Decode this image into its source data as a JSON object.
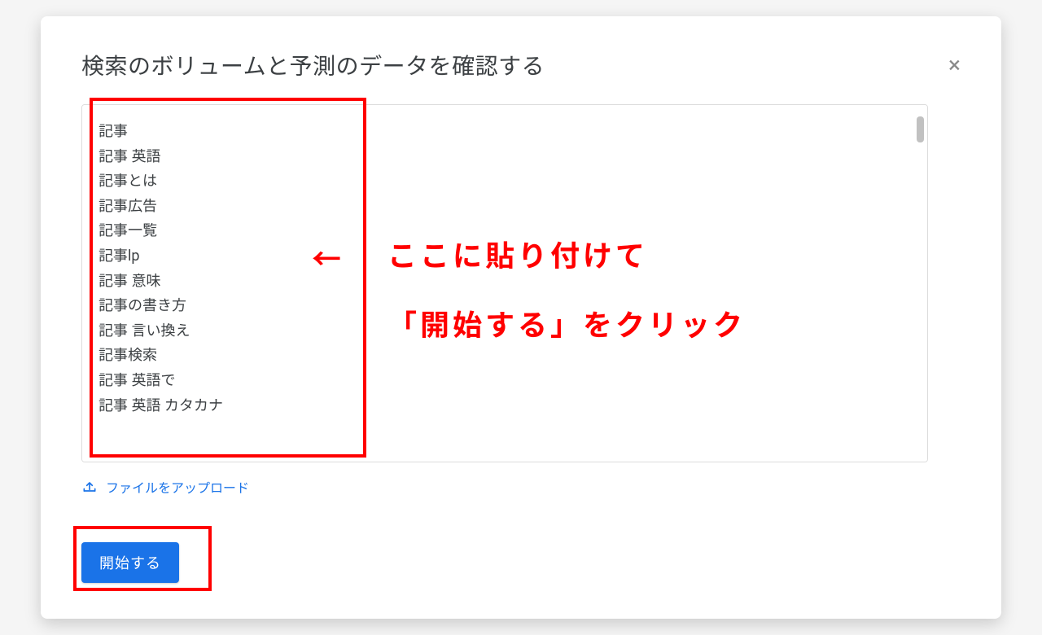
{
  "modal": {
    "title": "検索のボリュームと予測のデータを確認する",
    "keywords": "記事\n記事 英語\n記事とは\n記事広告\n記事一覧\n記事lp\n記事 意味\n記事の書き方\n記事 言い換え\n記事検索\n記事 英語で\n記事 英語 カタカナ",
    "upload_label": "ファイルをアップロード",
    "start_label": "開始する",
    "close_label": "×"
  },
  "annotation": {
    "arrow": "←",
    "text_line1": "ここに貼り付けて",
    "text_line2": "「開始する」をクリック"
  },
  "colors": {
    "accent": "#1a73e8",
    "annotation": "#ff0000"
  }
}
